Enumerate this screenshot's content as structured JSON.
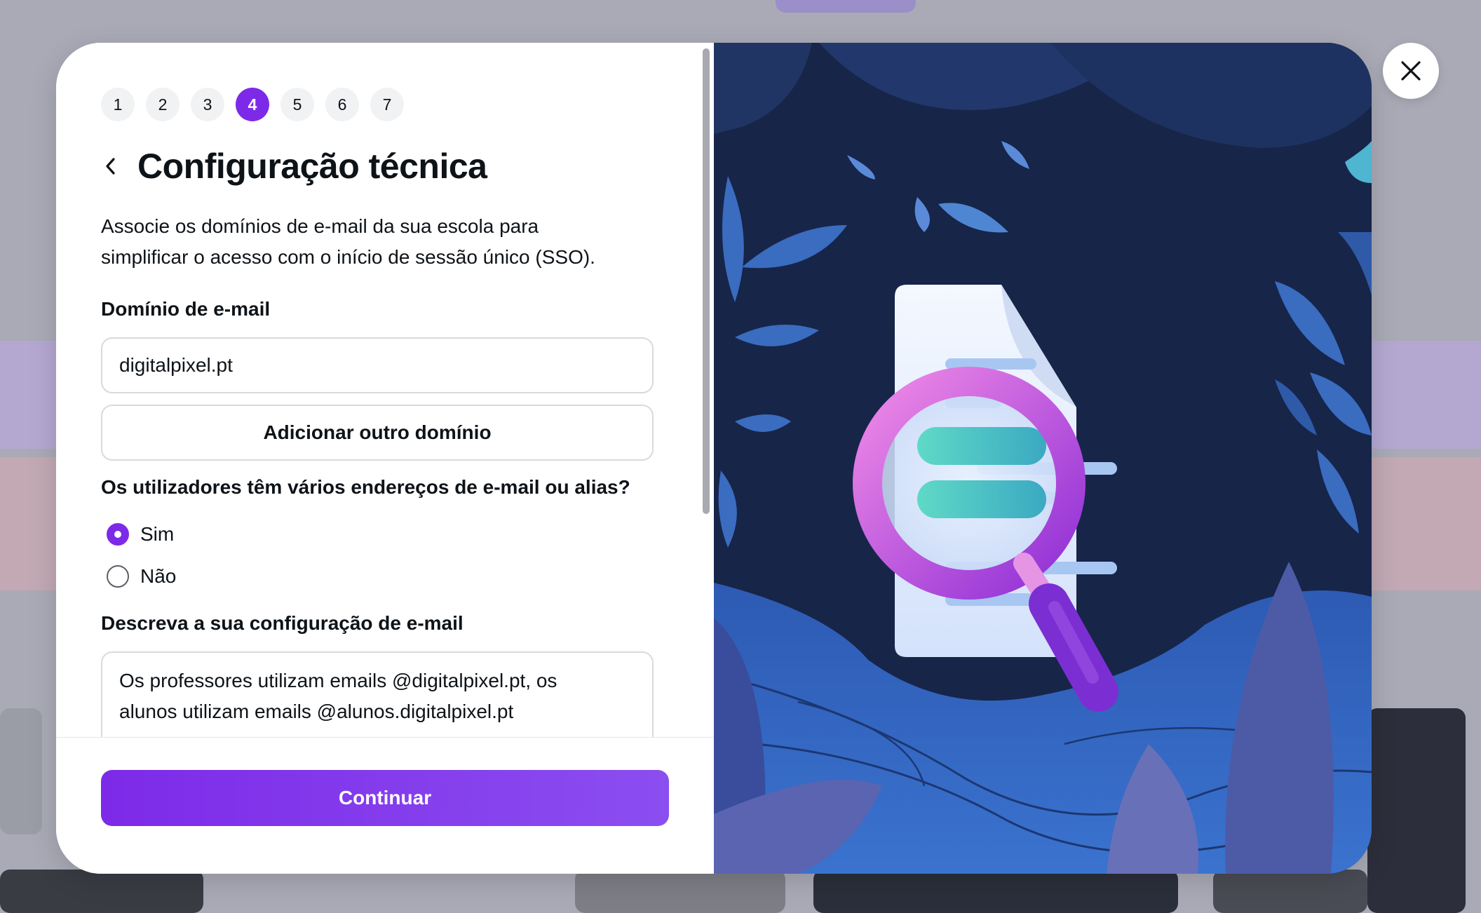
{
  "wizard": {
    "steps": [
      "1",
      "2",
      "3",
      "4",
      "5",
      "6",
      "7"
    ],
    "current_step": "4"
  },
  "header": {
    "title": "Configuração técnica"
  },
  "intro": {
    "line1": "Associe os domínios de e-mail da sua escola para",
    "line2": "simplificar o acesso com o início de sessão único (SSO)."
  },
  "email_domain": {
    "label": "Domínio de e-mail",
    "value": "digitalpixel.pt",
    "add_button": "Adicionar outro domínio"
  },
  "aliases": {
    "question": "Os utilizadores têm vários endereços de e-mail ou alias?",
    "options": [
      "Sim",
      "Não"
    ],
    "selected": "Sim"
  },
  "email_setup": {
    "label": "Descreva a sua configuração de e-mail",
    "line1": "Os professores utilizam emails @digitalpixel.pt, os",
    "line2": "alunos utilizam emails @alunos.digitalpixel.pt"
  },
  "footer": {
    "continue_label": "Continuar"
  },
  "colors": {
    "accent": "#7d2ae8",
    "illustration_bg": "#182647"
  },
  "icons": [
    "back-chevron-icon",
    "close-icon",
    "document-search-illustration"
  ]
}
